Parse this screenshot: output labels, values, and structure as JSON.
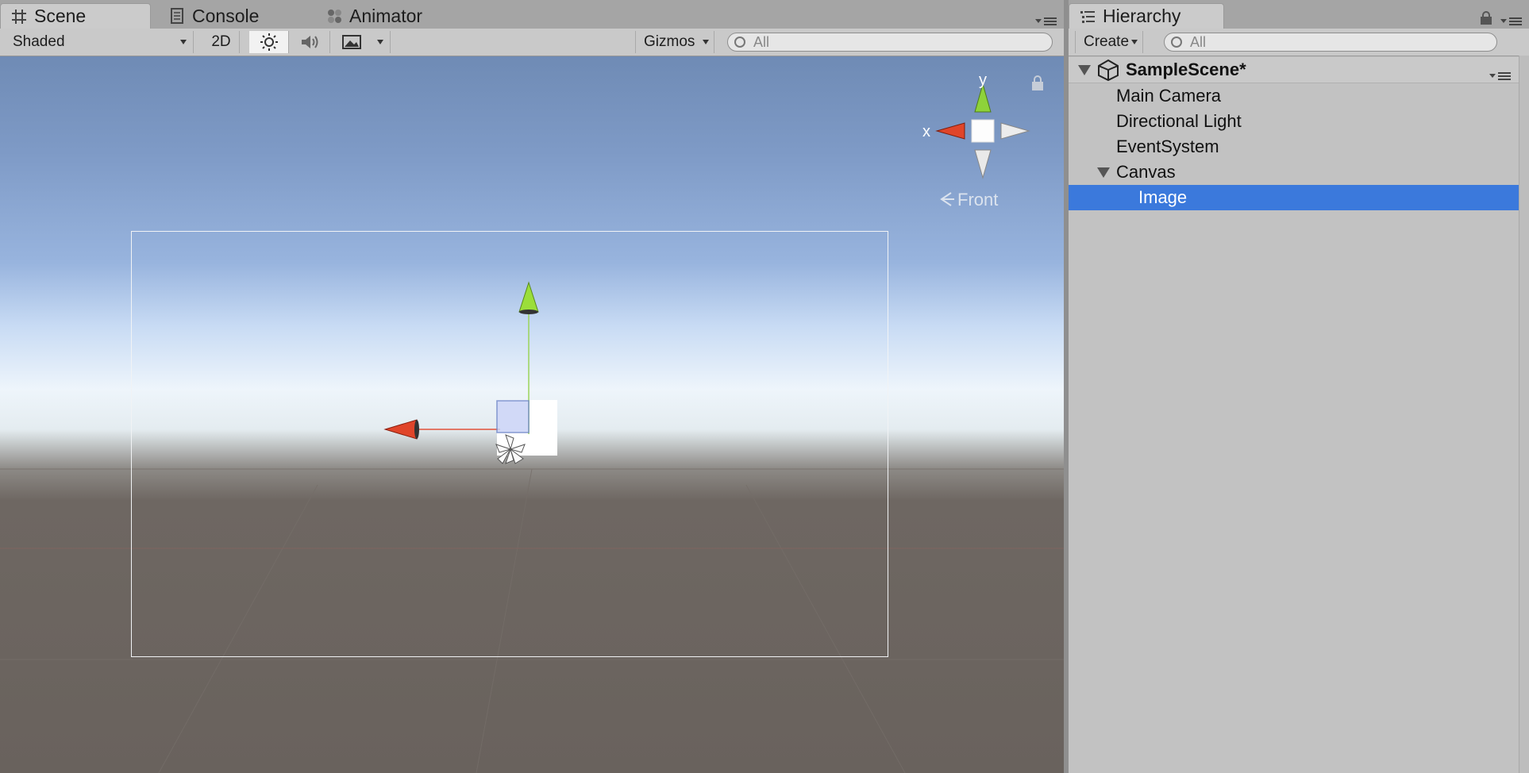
{
  "scene": {
    "tabs": [
      {
        "label": "Scene",
        "icon": "grid-icon",
        "active": true
      },
      {
        "label": "Console",
        "icon": "console-icon",
        "active": false
      },
      {
        "label": "Animator",
        "icon": "animator-icon",
        "active": false
      }
    ],
    "toolbar": {
      "shading_mode": "Shaded",
      "mode_2d": "2D",
      "gizmos": "Gizmos",
      "search_placeholder": "All"
    },
    "orientation_gizmo": {
      "x_label": "x",
      "y_label": "y",
      "view_label": "Front"
    }
  },
  "hierarchy": {
    "tab_label": "Hierarchy",
    "create_label": "Create",
    "search_placeholder": "All",
    "scene_name": "SampleScene*",
    "items": [
      {
        "label": "Main Camera",
        "depth": 1,
        "selected": false,
        "foldout": false
      },
      {
        "label": "Directional Light",
        "depth": 1,
        "selected": false,
        "foldout": false
      },
      {
        "label": "EventSystem",
        "depth": 1,
        "selected": false,
        "foldout": false
      },
      {
        "label": "Canvas",
        "depth": 1,
        "selected": false,
        "foldout": true
      },
      {
        "label": "Image",
        "depth": 2,
        "selected": true,
        "foldout": false
      }
    ]
  },
  "colors": {
    "selection": "#3b79dc",
    "x_axis": "#e0452a",
    "y_axis": "#8ed23a"
  }
}
